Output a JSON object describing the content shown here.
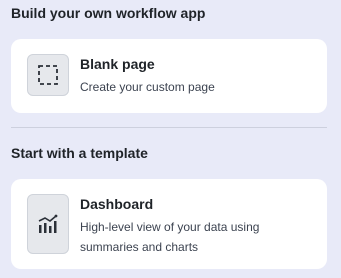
{
  "build_section": {
    "title": "Build your own workflow app",
    "card": {
      "title": "Blank page",
      "description": "Create your custom page",
      "icon": "dashed-square-icon"
    }
  },
  "template_section": {
    "title": "Start with a template",
    "card": {
      "title": "Dashboard",
      "description": "High-level view of your data using summaries and charts",
      "icon": "bar-chart-trend-icon"
    }
  }
}
